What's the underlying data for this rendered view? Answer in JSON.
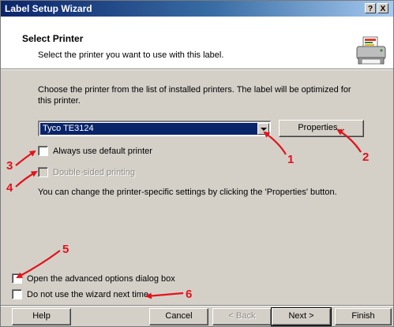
{
  "window": {
    "title": "Label Setup Wizard",
    "help_glyph": "?",
    "close_glyph": "X"
  },
  "header": {
    "title": "Select Printer",
    "subtitle": "Select the printer you want to use with this label.",
    "icon": "printer-icon"
  },
  "body": {
    "intro": "Choose the printer from the list of installed printers. The label will be optimized for this printer.",
    "printer_select": {
      "selected": "Tyco TE3124"
    },
    "properties_button": "Properties...",
    "always_default_label": "Always use default printer",
    "always_default_checked": false,
    "double_sided_label": "Double-sided printing",
    "double_sided_enabled": false,
    "settings_note": "You can change the printer-specific settings by clicking the 'Properties' button."
  },
  "options": {
    "advanced_label": "Open the advanced options dialog box",
    "no_wizard_label": "Do not use the wizard next time"
  },
  "buttons": {
    "help": "Help",
    "cancel": "Cancel",
    "back": "< Back",
    "next": "Next >",
    "finish": "Finish"
  },
  "annotations": {
    "color": "#e4121b",
    "markers": [
      "1",
      "2",
      "3",
      "4",
      "5",
      "6"
    ]
  }
}
